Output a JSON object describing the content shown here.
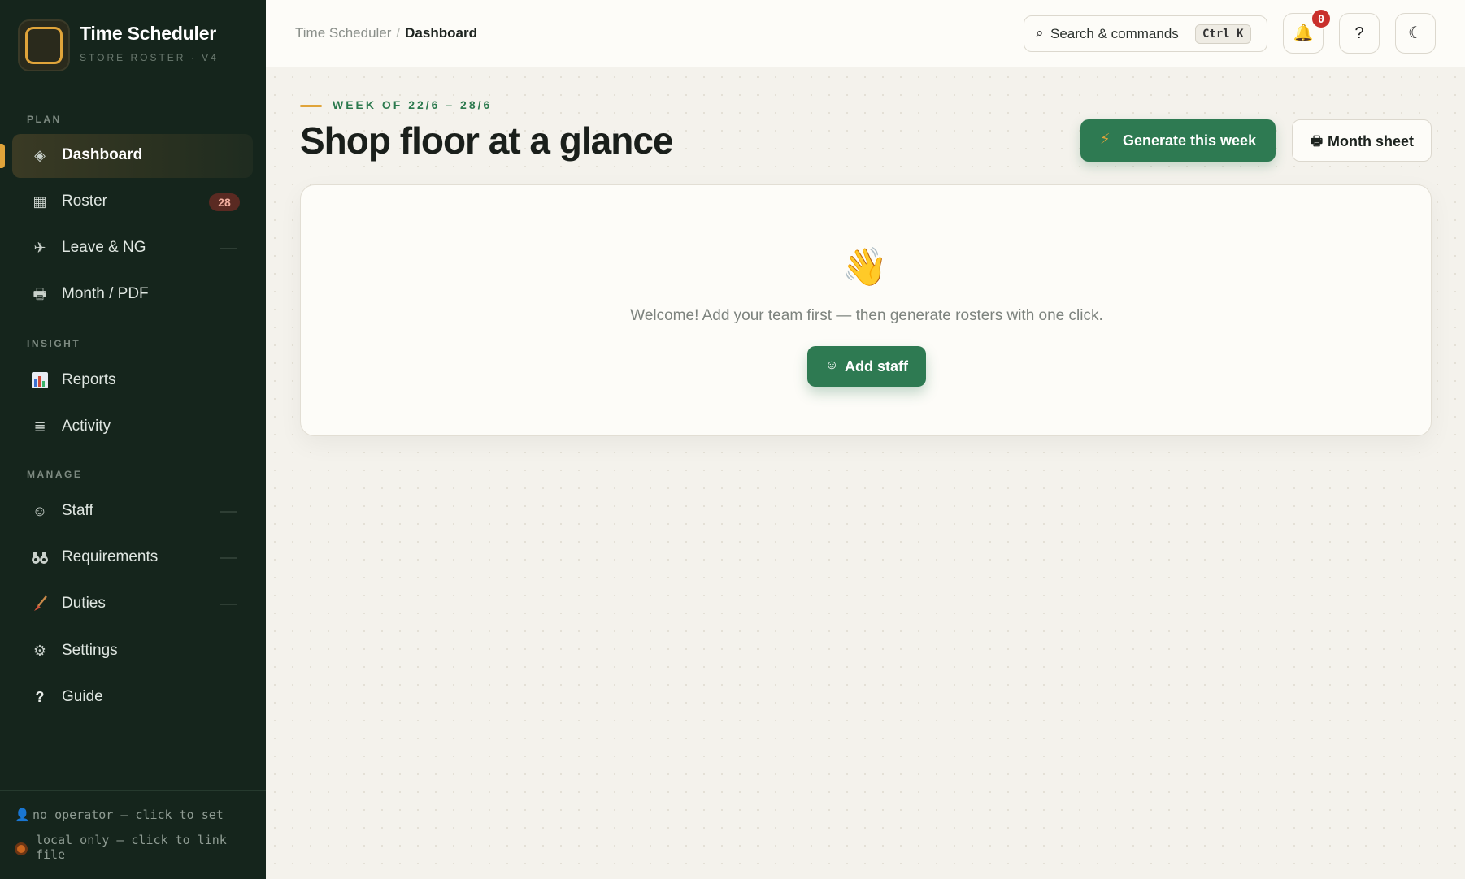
{
  "brand": {
    "title": "Time Scheduler",
    "subtitle": "STORE ROSTER · V4",
    "accent": "#e0a43a"
  },
  "sidebar": {
    "sections": {
      "plan": "PLAN",
      "insight": "INSIGHT",
      "manage": "MANAGE"
    },
    "items": [
      {
        "id": "dashboard",
        "label": "Dashboard",
        "icon": "diamond-icon",
        "active": true
      },
      {
        "id": "roster",
        "label": "Roster",
        "icon": "grid-icon",
        "badge": "28"
      },
      {
        "id": "leave",
        "label": "Leave & NG",
        "icon": "airplane-icon"
      },
      {
        "id": "month",
        "label": "Month / PDF",
        "icon": "printer-icon"
      },
      {
        "id": "reports",
        "label": "Reports",
        "icon": "bar-chart-icon"
      },
      {
        "id": "activity",
        "label": "Activity",
        "icon": "list-icon"
      },
      {
        "id": "staff",
        "label": "Staff",
        "icon": "smiley-icon"
      },
      {
        "id": "requirements",
        "label": "Requirements",
        "icon": "binoculars-icon"
      },
      {
        "id": "duties",
        "label": "Duties",
        "icon": "broom-icon"
      },
      {
        "id": "settings",
        "label": "Settings",
        "icon": "gear-icon"
      },
      {
        "id": "guide",
        "label": "Guide",
        "icon": "question-icon"
      }
    ],
    "footer": {
      "operator": "no operator — click to set",
      "storage_line1": "local only — click to link",
      "storage_line2": "file"
    }
  },
  "topbar": {
    "breadcrumb_root": "Time Scheduler",
    "breadcrumb_sep": "/",
    "breadcrumb_current": "Dashboard",
    "search_label": "Search & commands",
    "search_shortcut": "Ctrl K",
    "notification_count": "0",
    "help_label": "?",
    "theme_label": "☾"
  },
  "main": {
    "eyebrow": "WEEK OF 22/6 – 28/6",
    "title": "Shop floor at a glance",
    "generate_label": "Generate this week",
    "month_sheet_label": "Month sheet",
    "empty_state": {
      "emoji": "👋",
      "message": "Welcome! Add your team first — then generate rosters with one click.",
      "add_staff_label": "Add staff"
    }
  },
  "colors": {
    "sidebar_bg": "#15251c",
    "primary_green": "#2e7a52",
    "badge_red": "#c9302c",
    "page_bg": "#f4f2ec"
  }
}
